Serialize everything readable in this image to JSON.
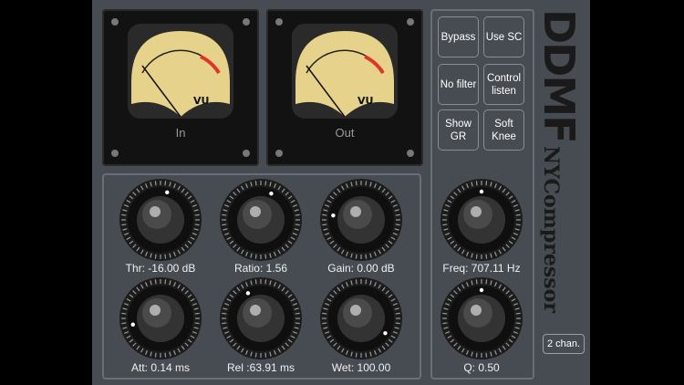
{
  "meters": [
    {
      "label": "In",
      "unit": "VU"
    },
    {
      "label": "Out",
      "unit": "VU"
    }
  ],
  "buttons": [
    {
      "id": "bypass",
      "label": "Bypass"
    },
    {
      "id": "use-sc",
      "label": "Use SC"
    },
    {
      "id": "no-filter",
      "label": "No filter"
    },
    {
      "id": "control-listen",
      "label": "Control\nlisten"
    },
    {
      "id": "show-gr",
      "label": "Show\nGR"
    },
    {
      "id": "soft-knee",
      "label": "Soft\nKnee"
    }
  ],
  "knobs": {
    "threshold": {
      "label": "Thr: -16.00 dB",
      "value": 0.55
    },
    "ratio": {
      "label": "Ratio: 1.56",
      "value": 0.58
    },
    "gain": {
      "label": "Gain: 0.00 dB",
      "value": 0.2
    },
    "attack": {
      "label": "Att: 0.14 ms",
      "value": 0.12
    },
    "release": {
      "label": "Rel :63.91 ms",
      "value": 0.4
    },
    "wet": {
      "label": "Wet: 100.00",
      "value": 0.95
    },
    "freq": {
      "label": "Freq: 707.11 Hz",
      "value": 0.5
    },
    "q": {
      "label": "Q: 0.50",
      "value": 0.5
    }
  },
  "brand": {
    "logo": "DDMF",
    "name": "NYCompressor"
  },
  "channels": {
    "label": "2 chan."
  },
  "colors": {
    "panel": "#474b52",
    "meter_face": "#e6d28a",
    "red_zone": "#e0342a"
  }
}
